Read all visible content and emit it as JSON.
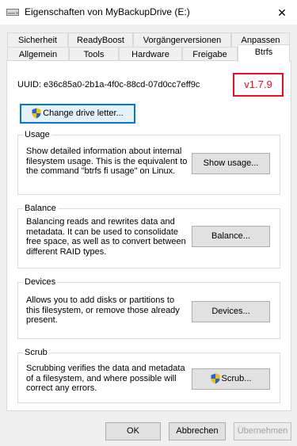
{
  "window": {
    "title": "Eigenschaften von MyBackupDrive (E:)",
    "close_glyph": "✕"
  },
  "tabs_row1": [
    "Sicherheit",
    "ReadyBoost",
    "Vorgängerversionen",
    "Anpassen"
  ],
  "tabs_row2": [
    "Allgemein",
    "Tools",
    "Hardware",
    "Freigabe",
    "Btrfs"
  ],
  "uuid": "UUID:  e36c85a0-2b1a-4f0c-88cd-07d0cc7eff9c",
  "version": "v1.7.9",
  "change_drive_button": "Change drive letter...",
  "usage": {
    "title": "Usage",
    "text": [
      "Show detailed information about internal",
      "filesystem usage. This is the equivalent to",
      "the command \"btrfs fi usage\" on Linux."
    ],
    "button": "Show usage..."
  },
  "balance": {
    "title": "Balance",
    "text": [
      "Balancing reads and rewrites data and",
      "metadata. It can be used to consolidate",
      "free space, as well as to convert between",
      "different RAID types."
    ],
    "button": "Balance..."
  },
  "devices": {
    "title": "Devices",
    "text": [
      "Allows you to add disks or partitions to",
      "this filesystem, or remove those already",
      "present."
    ],
    "button": "Devices..."
  },
  "scrub": {
    "title": "Scrub",
    "text": [
      "Scrubbing verifies the data and metadata",
      "of a filesystem, and where possible will",
      "correct any errors."
    ],
    "button": "Scrub..."
  },
  "footer": {
    "ok": "OK",
    "cancel": "Abbrechen",
    "apply": "Übernehmen"
  },
  "colors": {
    "version_border": "#e81123",
    "version_text": "#e81123",
    "focus_blue": "#0078d7"
  }
}
